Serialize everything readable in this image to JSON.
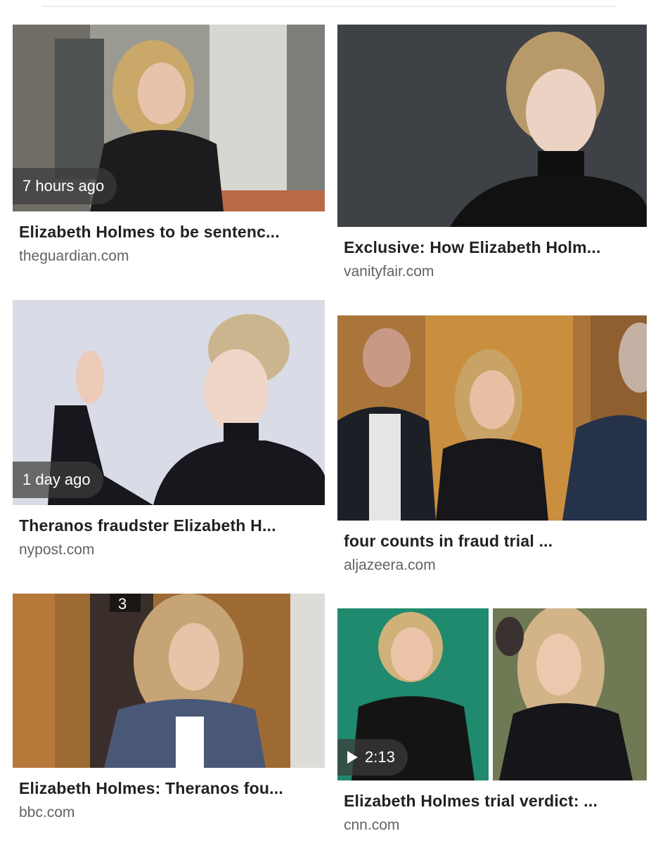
{
  "results": [
    {
      "title": "Elizabeth Holmes to be sentenc...",
      "source": "theguardian.com",
      "badge": "7 hours ago"
    },
    {
      "title": "Exclusive: How Elizabeth Holm...",
      "source": "vanityfair.com"
    },
    {
      "title": "Theranos fraudster Elizabeth H...",
      "source": "nypost.com",
      "badge": "1 day ago"
    },
    {
      "title": "four counts in fraud trial ...",
      "source": "aljazeera.com"
    },
    {
      "title": "Elizabeth Holmes: Theranos fou...",
      "source": "bbc.com",
      "sign": "3"
    },
    {
      "title": "Elizabeth Holmes trial verdict: ...",
      "source": "cnn.com",
      "badge": "2:13",
      "badge_icon": "play-icon"
    }
  ],
  "colors": {
    "title": "#202124",
    "source": "#5f6368",
    "badge_bg": "#3c3c3c"
  }
}
